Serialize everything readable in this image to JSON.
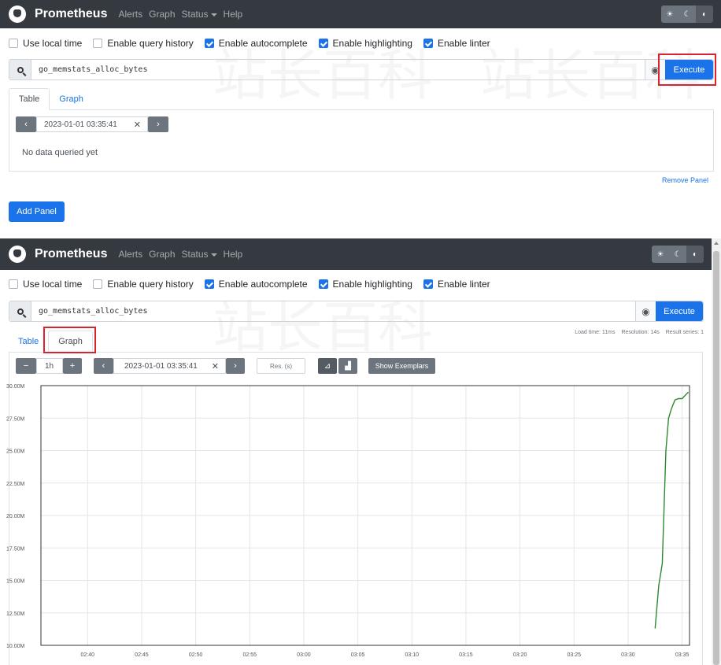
{
  "navbar": {
    "brand": "Prometheus",
    "links": [
      "Alerts",
      "Graph",
      "Status",
      "Help"
    ]
  },
  "options": [
    {
      "label": "Use local time",
      "checked": false
    },
    {
      "label": "Enable query history",
      "checked": false
    },
    {
      "label": "Enable autocomplete",
      "checked": true
    },
    {
      "label": "Enable highlighting",
      "checked": true
    },
    {
      "label": "Enable linter",
      "checked": true
    }
  ],
  "query": {
    "value": "go_memstats_alloc_bytes",
    "execute_label": "Execute"
  },
  "tabs": {
    "table": "Table",
    "graph": "Graph"
  },
  "table_view": {
    "eval_time": "2023-01-01 03:35:41",
    "no_data": "No data queried yet",
    "remove_panel": "Remove Panel",
    "add_panel": "Add Panel"
  },
  "graph_view": {
    "stats": {
      "load": "Load time: 11ms",
      "resolution": "Resolution: 14s",
      "series": "Result series: 1"
    },
    "range": "1h",
    "end_time": "2023-01-01 03:35:41",
    "res_placeholder": "Res. (s)",
    "show_exemplars": "Show Exemplars"
  },
  "colors": {
    "primary": "#1a73e8",
    "navbar": "#343a40",
    "series": "#2c8a2c",
    "highlight": "#d9232f"
  },
  "chart_data": {
    "type": "line",
    "y_ticks": [
      "10.00M",
      "12.50M",
      "15.00M",
      "17.50M",
      "20.00M",
      "22.50M",
      "25.00M",
      "27.50M",
      "30.00M"
    ],
    "x_ticks": [
      "02:40",
      "02:45",
      "02:50",
      "02:55",
      "03:00",
      "03:05",
      "03:10",
      "03:15",
      "03:20",
      "03:25",
      "03:30",
      "03:35"
    ],
    "ylim": [
      10000000,
      30000000
    ],
    "xlim": [
      "02:35:41",
      "03:35:41"
    ],
    "grid": true,
    "series": [
      {
        "x": [
          "03:32:30",
          "03:32:50",
          "03:33:10",
          "03:33:30",
          "03:33:45",
          "03:34:00",
          "03:34:20",
          "03:34:40",
          "03:35:00",
          "03:35:20",
          "03:35:35"
        ],
        "y": [
          11300000,
          14600000,
          16300000,
          25000000,
          27500000,
          28200000,
          28900000,
          29000000,
          29000000,
          29300000,
          29500000
        ]
      }
    ]
  }
}
